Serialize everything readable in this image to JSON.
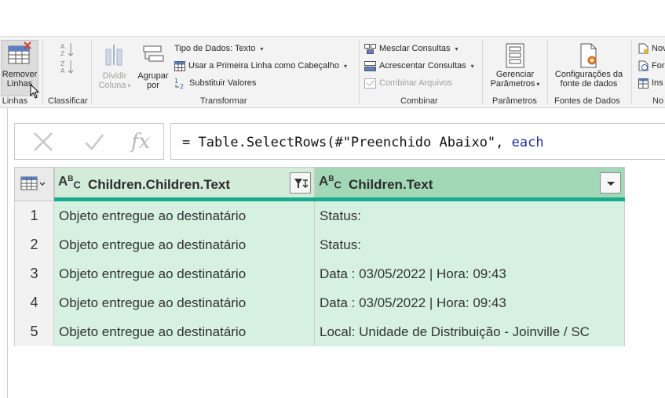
{
  "ribbon": {
    "remover_linhas": {
      "line1": "Remover",
      "line2": "Linhas"
    },
    "group_linhas": "r Linhas",
    "group_classificar": "Classificar",
    "dividir_coluna": {
      "line1": "Dividir",
      "line2": "Coluna"
    },
    "agrupar_por": {
      "line1": "Agrupar",
      "line2": "por"
    },
    "tipo_dados": "Tipo de Dados: Texto",
    "usar_primeira_linha": "Usar a Primeira Linha como Cabeçalho",
    "substituir_valores": "Substituir Valores",
    "group_transformar": "Transformar",
    "mesclar_consultas": "Mesclar Consultas",
    "acrescentar_consultas": "Acrescentar Consultas",
    "combinar_arquivos": "Combinar Arquivos",
    "group_combinar": "Combinar",
    "gerenciar_parametros": {
      "line1": "Gerenciar",
      "line2": "Parâmetros"
    },
    "group_parametros": "Parâmetros",
    "config_fonte": {
      "line1": "Configurações da",
      "line2": "fonte de dados"
    },
    "group_fontes": "Fontes de Dados",
    "nova_trunc": "Nov",
    "fonte_trunc": "For",
    "inserir_trunc": "Ins",
    "group_nova_trunc": "No"
  },
  "formula_bar": {
    "fx": "fx",
    "formula_prefix": "= Table.SelectRows(#\"Preenchido Abaixo\", ",
    "formula_keyword": "each"
  },
  "table": {
    "columns": [
      {
        "name": "Children.Children.Text",
        "type_icon": "ABC"
      },
      {
        "name": "Children.Text",
        "type_icon": "ABC"
      }
    ],
    "rows": [
      {
        "n": "1",
        "a": "Objeto entregue ao destinatário",
        "b": "Status:"
      },
      {
        "n": "2",
        "a": "Objeto entregue ao destinatário",
        "b": "Status:"
      },
      {
        "n": "3",
        "a": "Objeto entregue ao destinatário",
        "b": "Data  : 03/05/2022 | Hora: 09:43"
      },
      {
        "n": "4",
        "a": "Objeto entregue ao destinatário",
        "b": "Data  : 03/05/2022 | Hora: 09:43"
      },
      {
        "n": "5",
        "a": "Objeto entregue ao destinatário",
        "b": "Local: Unidade de Distribuição - Joinville / SC"
      }
    ]
  },
  "colors": {
    "ribbon_bg": "#f3f3f3",
    "col1_header": "#d3ecd9",
    "col2_header": "#a2d8b6",
    "cell_bg": "#d6f1e1",
    "quality_bar": "#1aab8e"
  }
}
